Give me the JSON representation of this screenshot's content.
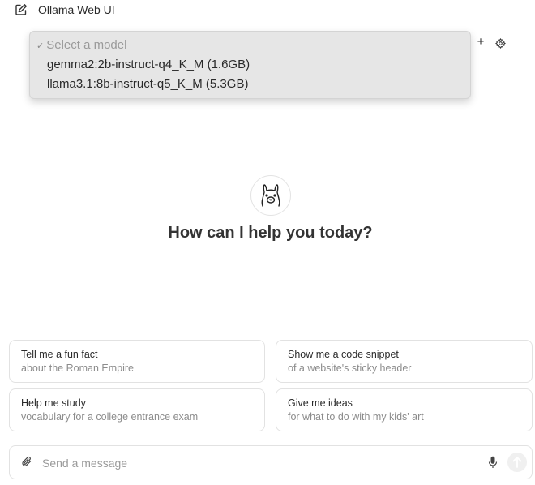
{
  "header": {
    "title": "Ollama Web UI",
    "new_chat_icon": "edit-square-icon"
  },
  "model_selector": {
    "placeholder_check": "✓",
    "placeholder": "Select a model",
    "options": [
      "gemma2:2b-instruct-q4_K_M (1.6GB)",
      "llama3.1:8b-instruct-q5_K_M (5.3GB)"
    ],
    "add_icon": "+",
    "settings_icon": "gear-icon"
  },
  "main": {
    "logo": "llama-logo",
    "headline": "How can I help you today?"
  },
  "suggestions": [
    {
      "title": "Tell me a fun fact",
      "subtitle": "about the Roman Empire"
    },
    {
      "title": "Show me a code snippet",
      "subtitle": "of a website's sticky header"
    },
    {
      "title": "Help me study",
      "subtitle": "vocabulary for a college entrance exam"
    },
    {
      "title": "Give me ideas",
      "subtitle": "for what to do with my kids' art"
    }
  ],
  "composer": {
    "placeholder": "Send a message",
    "attach_icon": "paperclip-icon",
    "mic_icon": "microphone-icon",
    "send_icon": "arrow-up-icon"
  }
}
